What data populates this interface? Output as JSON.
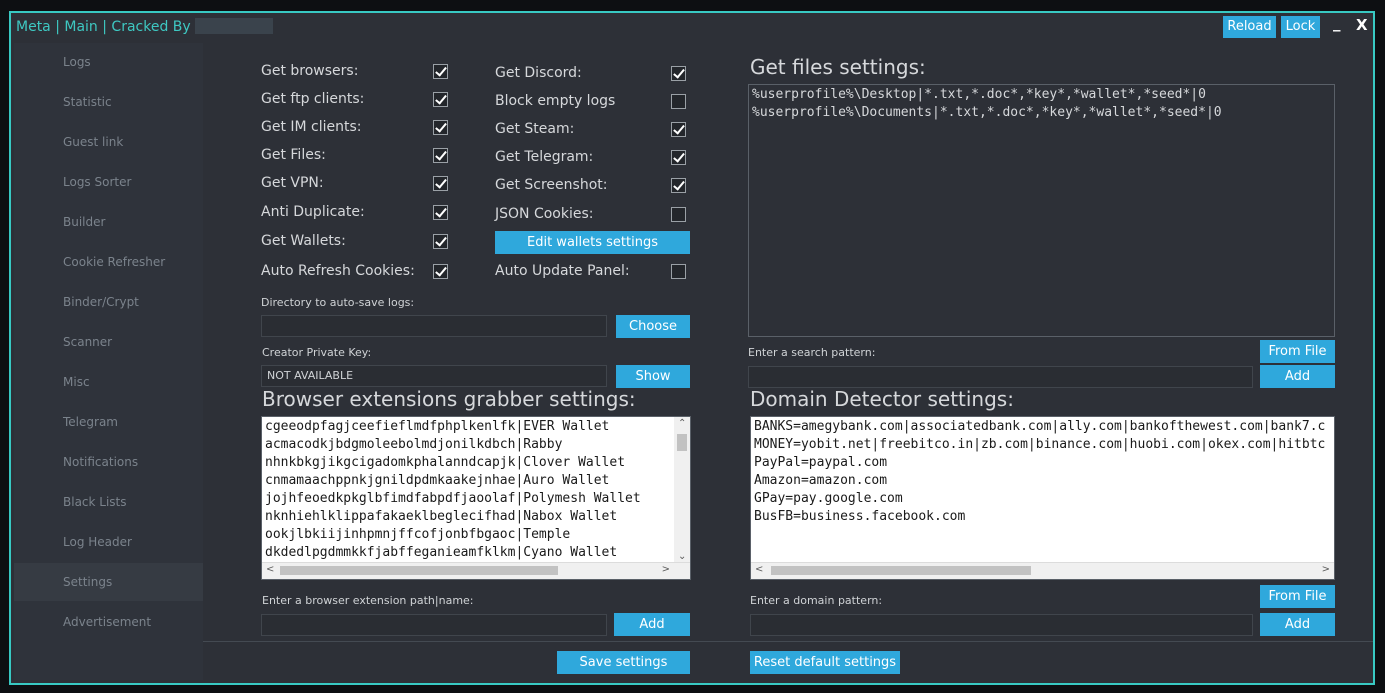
{
  "window": {
    "title": "Meta | Main | Cracked By",
    "reload": "Reload",
    "lock": "Lock",
    "minimize": "_",
    "close": "X"
  },
  "sidebar": {
    "items": [
      {
        "label": "Logs"
      },
      {
        "label": "Statistic"
      },
      {
        "label": "Guest link"
      },
      {
        "label": "Logs Sorter"
      },
      {
        "label": "Builder"
      },
      {
        "label": "Cookie Refresher"
      },
      {
        "label": "Binder/Crypt"
      },
      {
        "label": "Scanner"
      },
      {
        "label": "Misc"
      },
      {
        "label": "Telegram"
      },
      {
        "label": "Notifications"
      },
      {
        "label": "Black Lists"
      },
      {
        "label": "Log Header"
      },
      {
        "label": "Settings"
      },
      {
        "label": "Advertisement"
      }
    ],
    "active": "Settings"
  },
  "options_left": [
    {
      "label": "Get browsers:",
      "checked": true
    },
    {
      "label": "Get ftp clients:",
      "checked": true
    },
    {
      "label": "Get IM clients:",
      "checked": true
    },
    {
      "label": "Get Files:",
      "checked": true
    },
    {
      "label": "Get VPN:",
      "checked": true
    },
    {
      "label": "Anti Duplicate:",
      "checked": true
    },
    {
      "label": "Get Wallets:",
      "checked": true
    },
    {
      "label": "Auto Refresh Cookies:",
      "checked": true
    }
  ],
  "options_right": [
    {
      "label": "Get Discord:",
      "checked": true
    },
    {
      "label": "Block empty logs",
      "checked": false
    },
    {
      "label": "Get Steam:",
      "checked": true
    },
    {
      "label": "Get Telegram:",
      "checked": true
    },
    {
      "label": "Get Screenshot:",
      "checked": true
    },
    {
      "label": "JSON Cookies:",
      "checked": false
    },
    {
      "label": "Auto Update Panel:",
      "checked": false
    }
  ],
  "edit_wallets_label": "Edit wallets settings",
  "autosave": {
    "label": "Directory to auto-save logs:",
    "value": "",
    "button": "Choose"
  },
  "private_key": {
    "label": "Creator Private Key:",
    "value": "NOT AVAILABLE",
    "button": "Show"
  },
  "extensions": {
    "title": "Browser extensions grabber settings:",
    "lines": [
      "cgeeodpfagjceefieflmdfphplkenlfk|EVER Wallet",
      "acmacodkjbdgmoleebolmdjonilkdbch|Rabby",
      "nhnkbkgjikgcigadomkphalanndcapjk|Clover Wallet",
      "cnmamaachppnkjgnildpdmkaakejnhae|Auro Wallet",
      "jojhfeoedkpkglbfimdfabpdfjaoolaf|Polymesh Wallet",
      "nknhiehlklippafakaeklbeglecifhad|Nabox Wallet",
      "ookjlbkiijinhpmnjffcofjonbfbgaoc|Temple",
      "dkdedlpgdmmkkfjabffeganieamfklkm|Cyano Wallet"
    ],
    "input_label": "Enter a browser extension path|name:",
    "input_value": "",
    "add_button": "Add"
  },
  "files": {
    "title": "Get files settings:",
    "lines": [
      "%userprofile%\\Desktop|*.txt,*.doc*,*key*,*wallet*,*seed*|0",
      "%userprofile%\\Documents|*.txt,*.doc*,*key*,*wallet*,*seed*|0"
    ],
    "search_label": "Enter a search pattern:",
    "search_value": "",
    "from_file": "From File",
    "add_button": "Add"
  },
  "domains": {
    "title": "Domain Detector settings:",
    "lines": [
      "BANKS=amegybank.com|associatedbank.com|ally.com|bankofthewest.com|bank7.c",
      "MONEY=yobit.net|freebitco.in|zb.com|binance.com|huobi.com|okex.com|hitbtc",
      "PayPal=paypal.com",
      "Amazon=amazon.com",
      "GPay=pay.google.com",
      "BusFB=business.facebook.com"
    ],
    "input_label": "Enter a domain pattern:",
    "input_value": "",
    "from_file": "From File",
    "add_button": "Add"
  },
  "footer": {
    "save": "Save settings",
    "reset": "Reset default settings"
  },
  "colors": {
    "accent": "#38c9c3",
    "button": "#2fa8dc",
    "background": "#2d3037"
  }
}
